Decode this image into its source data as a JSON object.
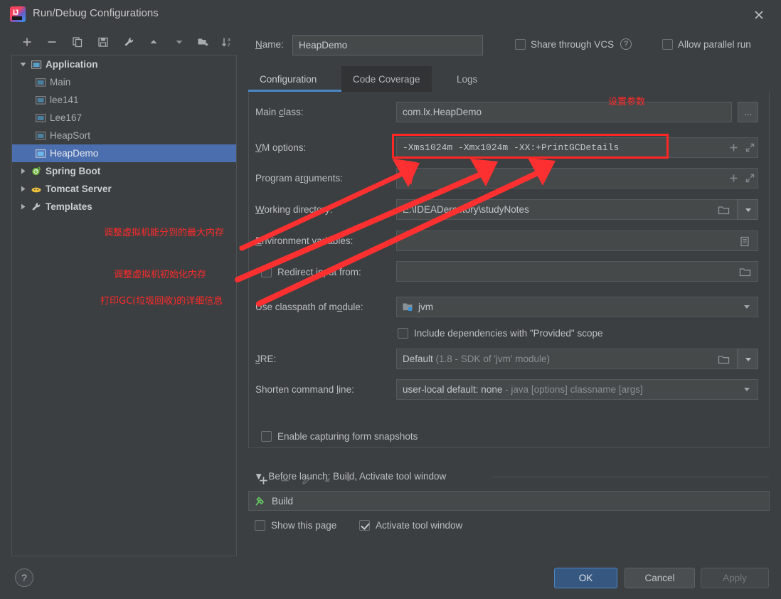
{
  "window": {
    "title": "Run/Debug Configurations",
    "close_icon": "close-icon",
    "app_icon": "intellij-idea-icon"
  },
  "tree_toolbar": [
    {
      "name": "add-configuration-button",
      "icon": "plus-icon"
    },
    {
      "name": "remove-configuration-button",
      "icon": "minus-icon"
    },
    {
      "name": "copy-configuration-button",
      "icon": "copy-icon"
    },
    {
      "name": "save-configuration-button",
      "icon": "save-icon"
    },
    {
      "name": "edit-templates-button",
      "icon": "wrench-icon"
    },
    {
      "name": "move-up-button",
      "icon": "arrow-up-icon"
    },
    {
      "name": "move-down-button",
      "icon": "arrow-down-icon"
    },
    {
      "name": "new-folder-button",
      "icon": "new-folder-icon"
    },
    {
      "name": "sort-configurations-button",
      "icon": "sort-az-icon"
    }
  ],
  "tree": {
    "items": [
      {
        "label": "Application",
        "level": 0,
        "expanded": true,
        "bold": true,
        "icon": "application-icon",
        "selected": false
      },
      {
        "label": "Main",
        "level": 1,
        "expanded": null,
        "bold": false,
        "icon": "application-icon",
        "selected": false
      },
      {
        "label": "lee141",
        "level": 1,
        "expanded": null,
        "bold": false,
        "icon": "application-icon",
        "selected": false
      },
      {
        "label": "Lee167",
        "level": 1,
        "expanded": null,
        "bold": false,
        "icon": "application-icon",
        "selected": false
      },
      {
        "label": "HeapSort",
        "level": 1,
        "expanded": null,
        "bold": false,
        "icon": "application-icon",
        "selected": false
      },
      {
        "label": "HeapDemo",
        "level": 1,
        "expanded": null,
        "bold": false,
        "icon": "application-icon",
        "selected": true
      },
      {
        "label": "Spring Boot",
        "level": 0,
        "expanded": false,
        "bold": true,
        "icon": "spring-boot-icon",
        "selected": false
      },
      {
        "label": "Tomcat Server",
        "level": 0,
        "expanded": false,
        "bold": true,
        "icon": "tomcat-icon",
        "selected": false
      },
      {
        "label": "Templates",
        "level": 0,
        "expanded": false,
        "bold": true,
        "icon": "wrench-icon",
        "selected": false
      }
    ]
  },
  "header": {
    "name_label": "Name:",
    "name_value": "HeapDemo",
    "share_vcs_label": "Share through VCS",
    "share_vcs_checked": false,
    "help_icon": "question-mark-icon",
    "allow_parallel_label": "Allow parallel run",
    "allow_parallel_checked": false
  },
  "tabs": [
    {
      "label": "Configuration",
      "active": true,
      "hover": false
    },
    {
      "label": "Code Coverage",
      "active": false,
      "hover": true
    },
    {
      "label": "Logs",
      "active": false,
      "hover": false
    }
  ],
  "form": {
    "main_class_label": "Main class:",
    "main_class_value": "com.lx.HeapDemo",
    "main_class_browse": "...",
    "vm_options_label": "VM options:",
    "vm_options_value": "-Xms1024m  -Xmx1024m  -XX:+PrintGCDetails",
    "program_arguments_label": "Program arguments:",
    "program_arguments_value": "",
    "working_directory_label": "Working directory:",
    "working_directory_value": "E:\\IDEADerectory\\studyNotes",
    "environment_variables_label": "Environment variables:",
    "environment_variables_value": "",
    "redirect_input_label": "Redirect input from:",
    "redirect_input_checked": false,
    "redirect_input_value": "",
    "classpath_module_label": "Use classpath of module:",
    "classpath_module_value": "jvm",
    "include_provided_label": "Include dependencies with \"Provided\" scope",
    "include_provided_checked": false,
    "jre_label": "JRE:",
    "jre_value": "Default",
    "jre_value_dim": "(1.8 - SDK of 'jvm' module)",
    "shorten_cmd_label": "Shorten command line:",
    "shorten_cmd_value": "user-local default: none",
    "shorten_cmd_dim": "- java [options] classname [args]",
    "form_snapshots_label": "Enable capturing form snapshots",
    "form_snapshots_checked": false
  },
  "before_launch": {
    "header": "Before launch: Build, Activate tool window",
    "toolbar": [
      {
        "name": "before-launch-add-button",
        "icon": "plus-icon",
        "enabled": true
      },
      {
        "name": "before-launch-remove-button",
        "icon": "minus-icon",
        "enabled": false
      },
      {
        "name": "before-launch-edit-button",
        "icon": "pencil-icon",
        "enabled": false
      },
      {
        "name": "before-launch-move-up-button",
        "icon": "arrow-up-icon",
        "enabled": false
      },
      {
        "name": "before-launch-move-down-button",
        "icon": "arrow-down-icon",
        "enabled": false
      }
    ],
    "task_label": "Build",
    "task_icon": "build-hammer-icon",
    "show_page_label": "Show this page",
    "show_page_checked": false,
    "activate_window_label": "Activate tool window",
    "activate_window_checked": true
  },
  "footer": {
    "help_label": "?",
    "ok_label": "OK",
    "cancel_label": "Cancel",
    "apply_label": "Apply"
  },
  "annotations": {
    "color": "#ff2626",
    "top_label": "设置参数",
    "note_max_memory": "调整虚拟机能分到的最大内存",
    "note_initial_memory": "调整虚拟机初始化内存",
    "note_gc_details": "打印GC(垃圾回收)的详细信息"
  }
}
